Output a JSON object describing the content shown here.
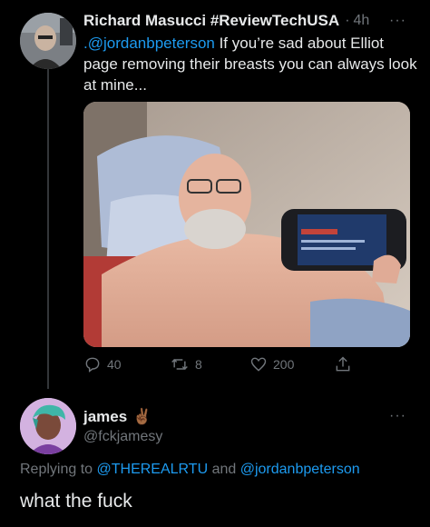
{
  "tweet": {
    "author_name": "Richard Masucci #ReviewTechUSA",
    "separator": "·",
    "time": "4h",
    "more": "···",
    "mention": ".@jordanbpeterson",
    "text": " If you’re sad about Elliot page removing their breasts you can always look at mine...",
    "counts": {
      "replies": "40",
      "retweets": "8",
      "likes": "200"
    }
  },
  "reply": {
    "author_name": "james",
    "emoji": "✌🏾",
    "handle": "@fckjamesy",
    "more": "···",
    "replying_prefix": "Replying to ",
    "replying_to_1": "@THEREALRTU",
    "replying_and": " and ",
    "replying_to_2": "@jordanbpeterson",
    "text": "what the fuck"
  },
  "icons": {
    "reply": "reply-icon",
    "retweet": "retweet-icon",
    "like": "heart-icon",
    "share": "share-icon"
  },
  "colors": {
    "background": "#000000",
    "text": "#e7e9ea",
    "muted": "#71767b",
    "accent": "#1d9bf0"
  }
}
